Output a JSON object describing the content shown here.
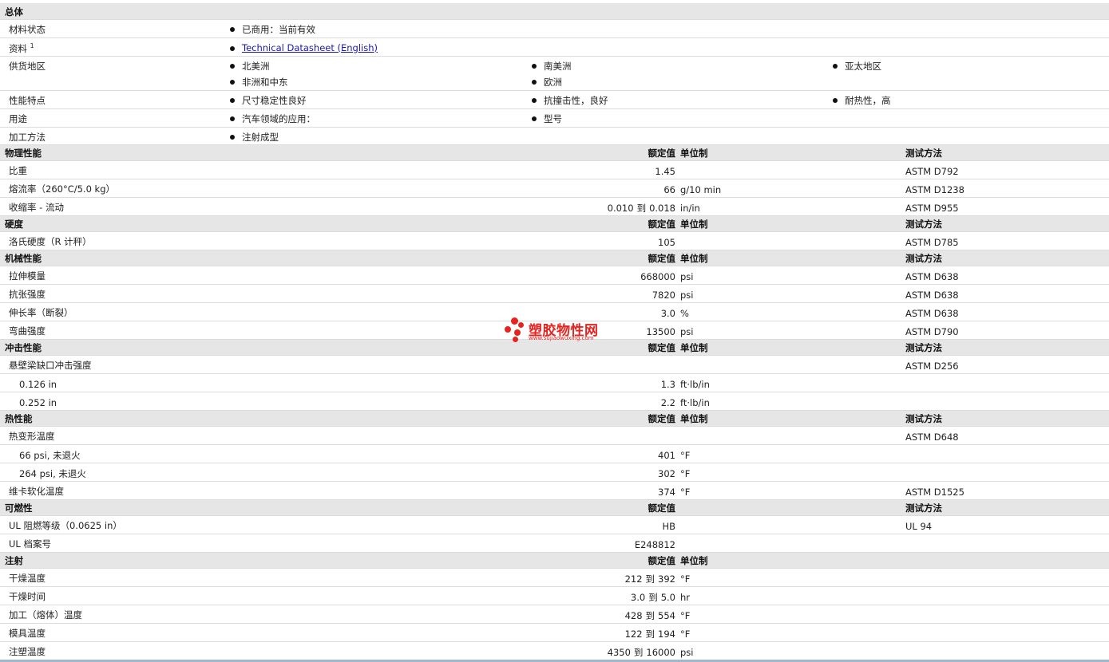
{
  "general": {
    "title": "总体",
    "status_label": "材料状态",
    "status_value": "已商用：当前有效",
    "docs_label": "资料",
    "docs_sup": "1",
    "docs_link": "Technical Datasheet (English)",
    "avail_label": "供货地区",
    "avail": [
      "北美洲",
      "南美洲",
      "亚太地区",
      "非洲和中东",
      "欧洲"
    ],
    "features_label": "性能特点",
    "features": [
      "尺寸稳定性良好",
      "抗撞击性，良好",
      "耐热性，高"
    ],
    "uses_label": "用途",
    "uses": [
      "汽车领域的应用：",
      "型号"
    ],
    "process_label": "加工方法",
    "process": "注射成型"
  },
  "headers": {
    "value": "额定值",
    "unit": "单位制",
    "method": "测试方法"
  },
  "physical": {
    "title": "物理性能",
    "rows": [
      {
        "label": "比重",
        "value": "1.45",
        "unit": "",
        "method": "ASTM D792"
      },
      {
        "label": "熔流率（260°C/5.0 kg）",
        "value": "66",
        "unit": "g/10 min",
        "method": "ASTM D1238"
      },
      {
        "label": "收缩率 - 流动",
        "v1": "0.010",
        "to": "到",
        "v2": "0.018",
        "unit": "in/in",
        "method": "ASTM D955"
      }
    ]
  },
  "hardness": {
    "title": "硬度",
    "rows": [
      {
        "label": "洛氏硬度（R 计秤）",
        "value": "105",
        "unit": "",
        "method": "ASTM D785"
      }
    ]
  },
  "mechanical": {
    "title": "机械性能",
    "rows": [
      {
        "label": "拉伸模量",
        "value": "668000",
        "unit": "psi",
        "method": "ASTM D638"
      },
      {
        "label": "抗张强度",
        "value": "7820",
        "unit": "psi",
        "method": "ASTM D638"
      },
      {
        "label": "伸长率（断裂）",
        "value": "3.0",
        "unit": "%",
        "method": "ASTM D638"
      },
      {
        "label": "弯曲强度",
        "value": "13500",
        "unit": "psi",
        "method": "ASTM D790"
      }
    ]
  },
  "impact": {
    "title": "冲击性能",
    "rows": [
      {
        "label": "悬壁梁缺口冲击强度",
        "value": "",
        "unit": "",
        "method": "ASTM D256"
      },
      {
        "label": "0.126 in",
        "value": "1.3",
        "unit": "ft·lb/in",
        "method": ""
      },
      {
        "label": "0.252 in",
        "value": "2.2",
        "unit": "ft·lb/in",
        "method": ""
      }
    ]
  },
  "thermal": {
    "title": "热性能",
    "rows": [
      {
        "label": "热变形温度",
        "value": "",
        "unit": "",
        "method": "ASTM D648"
      },
      {
        "label": "66 psi, 未退火",
        "value": "401",
        "unit": "°F",
        "method": ""
      },
      {
        "label": "264 psi, 未退火",
        "value": "302",
        "unit": "°F",
        "method": ""
      },
      {
        "label": "维卡软化温度",
        "value": "374",
        "unit": "°F",
        "method": "ASTM D1525"
      }
    ]
  },
  "flammability": {
    "title": "可燃性",
    "rows": [
      {
        "label": "UL 阻燃等级（0.0625 in）",
        "value": "HB",
        "unit": "",
        "method": "UL 94"
      },
      {
        "label": "UL 档案号",
        "value": "E248812",
        "unit": "",
        "method": ""
      }
    ]
  },
  "injection": {
    "title": "注射",
    "rows": [
      {
        "label": "干燥温度",
        "v1": "212",
        "to": "到",
        "v2": "392",
        "unit": "°F"
      },
      {
        "label": "干燥时间",
        "v1": "3.0",
        "to": "到",
        "v2": "5.0",
        "unit": "hr"
      },
      {
        "label": "加工（熔体）温度",
        "v1": "428",
        "to": "到",
        "v2": "554",
        "unit": "°F"
      },
      {
        "label": "模具温度",
        "v1": "122",
        "to": "到",
        "v2": "194",
        "unit": "°F"
      },
      {
        "label": "注塑温度",
        "v1": "4350",
        "to": "到",
        "v2": "16000",
        "unit": "psi"
      }
    ]
  },
  "watermark": {
    "cn": "塑胶物性网",
    "url": "www.sujiaowuxing.com",
    "color": "#e8231f"
  }
}
